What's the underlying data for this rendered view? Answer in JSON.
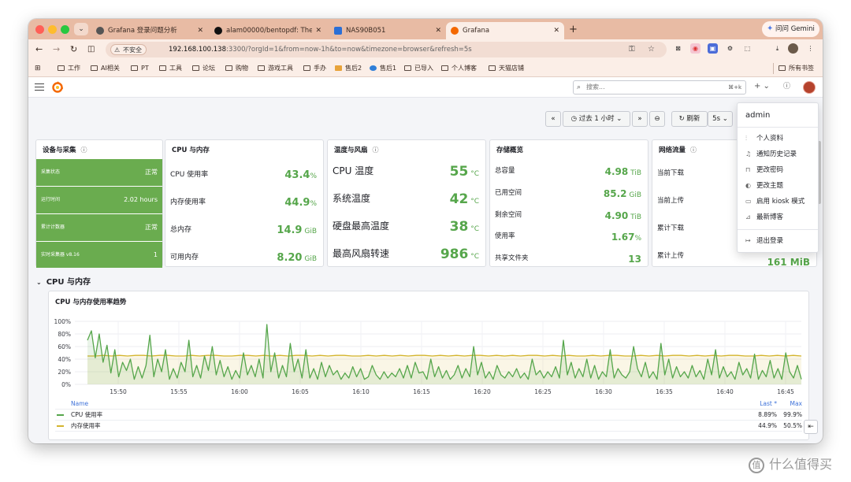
{
  "browser": {
    "tabs": [
      {
        "title": "Grafana 登录问题分析",
        "icon": "openai-icon",
        "color": "#555555"
      },
      {
        "title": "alam00000/bentopdf: The Pr",
        "icon": "github-icon",
        "color": "#111111"
      },
      {
        "title": "NAS90B051",
        "icon": "nas-icon",
        "color": "#2b6fd6"
      },
      {
        "title": "Grafana",
        "icon": "grafana-icon",
        "color": "#f46800"
      }
    ],
    "gemini_label": "问问 Gemini",
    "insecure_label": "不安全",
    "url_host": "192.168.100.138",
    "url_rest": ":3300/?orgId=1&from=now-1h&to=now&timezone=browser&refresh=5s",
    "bookmarks": [
      "工作",
      "AI相关",
      "PT",
      "工具",
      "论坛",
      "购物",
      "游戏工具",
      "手办",
      "售后2",
      "售后1",
      "已导入",
      "个人博客",
      "天猫店铺"
    ],
    "all_bookmarks": "所有书签"
  },
  "grafana": {
    "search_placeholder": "搜索...",
    "search_shortcut": "⌘+k",
    "time_range": "过去 1 小时",
    "refresh_label": "刷新",
    "refresh_interval": "5s"
  },
  "panels": {
    "device": {
      "title": "设备与采集",
      "rows": [
        {
          "label": "采集状态",
          "value": "正常"
        },
        {
          "label": "运行时间",
          "value": "2.02 hours"
        },
        {
          "label": "累计计数器",
          "value": "正常"
        },
        {
          "label": "实时采集器 v8.16",
          "value": "1"
        }
      ]
    },
    "cpu_mem": {
      "title": "CPU 与内存",
      "rows": [
        {
          "label": "CPU 使用率",
          "value": "43.4",
          "unit": "%"
        },
        {
          "label": "内存使用率",
          "value": "44.9",
          "unit": "%"
        },
        {
          "label": "总内存",
          "value": "14.9",
          "unit": " GiB"
        },
        {
          "label": "可用内存",
          "value": "8.20",
          "unit": " GiB"
        }
      ]
    },
    "temp_fan": {
      "title": "温度与风扇",
      "rows": [
        {
          "label": "CPU 温度",
          "value": "55",
          "unit": " °C"
        },
        {
          "label": "系统温度",
          "value": "42",
          "unit": " °C"
        },
        {
          "label": "硬盘最高温度",
          "value": "38",
          "unit": " °C"
        },
        {
          "label": "最高风扇转速",
          "value": "986",
          "unit": " °C"
        }
      ]
    },
    "storage": {
      "title": "存储概览",
      "rows": [
        {
          "label": "总容量",
          "value": "4.98",
          "unit": " TiB"
        },
        {
          "label": "已用空间",
          "value": "85.2",
          "unit": " GiB"
        },
        {
          "label": "剩余空间",
          "value": "4.90",
          "unit": " TiB"
        },
        {
          "label": "使用率",
          "value": "1.67",
          "unit": "%"
        },
        {
          "label": "共享文件夹",
          "value": "13",
          "unit": ""
        }
      ]
    },
    "network": {
      "title": "网络流量",
      "rows": [
        {
          "label": "当前下载"
        },
        {
          "label": "当前上传"
        },
        {
          "label": "累计下载"
        },
        {
          "label": "累计上传",
          "value": "161 MiB"
        }
      ]
    }
  },
  "section_title": "CPU 与内存",
  "user_menu": {
    "username": "admin",
    "items": [
      "个人资料",
      "通知历史记录",
      "更改密码",
      "更改主题",
      "启用 kiosk 模式",
      "最新博客",
      "退出登录"
    ]
  },
  "chart_data": {
    "type": "line",
    "title": "CPU 与内存使用率趋势",
    "x": [
      "15:50",
      "15:55",
      "16:00",
      "16:05",
      "16:10",
      "16:15",
      "16:20",
      "16:25",
      "16:30",
      "16:35",
      "16:40",
      "16:45"
    ],
    "ylim": [
      0,
      100
    ],
    "yticks": [
      "0%",
      "20%",
      "40%",
      "60%",
      "80%",
      "100%"
    ],
    "legend_headers": {
      "name": "Name",
      "last": "Last *",
      "max": "Max"
    },
    "series": [
      {
        "name": "CPU 使用率",
        "color": "#56a64b",
        "last": "8.89%",
        "max": "99.9%",
        "values": [
          70,
          85,
          42,
          80,
          35,
          62,
          18,
          55,
          12,
          35,
          22,
          40,
          8,
          28,
          10,
          30,
          78,
          12,
          40,
          20,
          55,
          8,
          25,
          10,
          35,
          20,
          70,
          12,
          30,
          10,
          45,
          22,
          60,
          15,
          38,
          12,
          28,
          8,
          22,
          10,
          50,
          15,
          30,
          12,
          40,
          10,
          95,
          20,
          50,
          10,
          30,
          12,
          65,
          20,
          40,
          10,
          55,
          10,
          25,
          8,
          35,
          12,
          30,
          15,
          22,
          8,
          18,
          10,
          28,
          12,
          25,
          8,
          12,
          30,
          15,
          8,
          20,
          10,
          18,
          12,
          25,
          10,
          30,
          10,
          35,
          18,
          20,
          8,
          40,
          12,
          28,
          10,
          22,
          8,
          15,
          30,
          10,
          25,
          12,
          60,
          15,
          35,
          10,
          20,
          8,
          30,
          15,
          10,
          20,
          12,
          25,
          10,
          18,
          8,
          40,
          15,
          22,
          10,
          20,
          12,
          28,
          10,
          70,
          15,
          35,
          10,
          25,
          12,
          40,
          10,
          30,
          8,
          20,
          12,
          55,
          10,
          25,
          15,
          10,
          20,
          60,
          25,
          12,
          35,
          10,
          20,
          8,
          65,
          15,
          40,
          10,
          28,
          12,
          20,
          10,
          30,
          12,
          22,
          8,
          40,
          15,
          55,
          10,
          28,
          12,
          20,
          8,
          35,
          15,
          25,
          10,
          48,
          8,
          22,
          12,
          38,
          10,
          25,
          8,
          50,
          20,
          10,
          30,
          8
        ]
      },
      {
        "name": "内存使用率",
        "color": "#d4b52e",
        "last": "44.9%",
        "max": "50.5%",
        "values": [
          45,
          45,
          46,
          45,
          46,
          45,
          46,
          46,
          45,
          46,
          46,
          45,
          45,
          46,
          45,
          46,
          46,
          45,
          45,
          46,
          46,
          45,
          46,
          45,
          46,
          45,
          46,
          46,
          45,
          46,
          45,
          46,
          46,
          45,
          45,
          46,
          45,
          46,
          45,
          46,
          45,
          46,
          46,
          45,
          46,
          45,
          46,
          45,
          46,
          46,
          45,
          46,
          45,
          46,
          45,
          46,
          46,
          45,
          46,
          45,
          46,
          45,
          45,
          46,
          45,
          46,
          46,
          45,
          45,
          46,
          45,
          46,
          45,
          46,
          46,
          45,
          46,
          45,
          46,
          45,
          46,
          46,
          45,
          45,
          46,
          45,
          46,
          45,
          46,
          45
        ]
      }
    ]
  }
}
